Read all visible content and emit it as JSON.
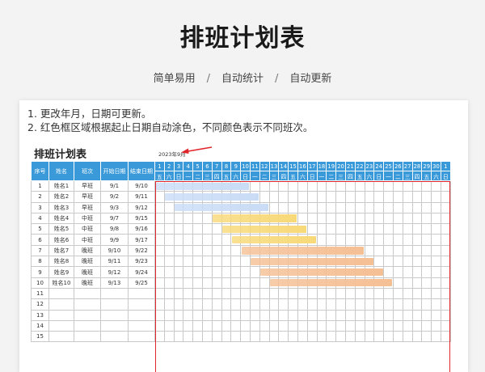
{
  "title": "排班计划表",
  "subtitle": {
    "items": [
      "简单易用",
      "自动统计",
      "自动更新"
    ],
    "separator": "/"
  },
  "notes": [
    "1. 更改年月，日期可更新。",
    "2. 红色框区域根据起止日期自动涂色，不同颜色表示不同班次。"
  ],
  "sheet": {
    "title": "排班计划表",
    "month_label": "2023年9月",
    "columns": [
      "序号",
      "姓名",
      "班次",
      "开始日期",
      "结束日期"
    ],
    "days": [
      "1",
      "2",
      "3",
      "4",
      "5",
      "6",
      "7",
      "8",
      "9",
      "10",
      "11",
      "12",
      "13",
      "14",
      "15",
      "16",
      "17",
      "18",
      "19",
      "20",
      "21",
      "22",
      "23",
      "24",
      "25",
      "26",
      "27",
      "28",
      "29",
      "30",
      "1"
    ],
    "weekdays": [
      "五",
      "六",
      "日",
      "一",
      "二",
      "三",
      "四",
      "五",
      "六",
      "日",
      "一",
      "二",
      "三",
      "四",
      "五",
      "六",
      "日",
      "一",
      "二",
      "三",
      "四",
      "五",
      "六",
      "日",
      "一",
      "二",
      "三",
      "四",
      "五",
      "六",
      "日"
    ],
    "rows": [
      {
        "no": "1",
        "name": "姓名1",
        "shift": "早班",
        "start": "9/1",
        "end": "9/10",
        "s": 1,
        "e": 10,
        "color": "#c9dcf6"
      },
      {
        "no": "2",
        "name": "姓名2",
        "shift": "早班",
        "start": "9/2",
        "end": "9/11",
        "s": 2,
        "e": 11,
        "color": "#c9dcf6"
      },
      {
        "no": "3",
        "name": "姓名3",
        "shift": "早班",
        "start": "9/3",
        "end": "9/12",
        "s": 3,
        "e": 12,
        "color": "#c9dcf6"
      },
      {
        "no": "4",
        "name": "姓名4",
        "shift": "中班",
        "start": "9/7",
        "end": "9/15",
        "s": 7,
        "e": 15,
        "color": "#f8d978"
      },
      {
        "no": "5",
        "name": "姓名5",
        "shift": "中班",
        "start": "9/8",
        "end": "9/16",
        "s": 8,
        "e": 16,
        "color": "#f8d978"
      },
      {
        "no": "6",
        "name": "姓名6",
        "shift": "中班",
        "start": "9/9",
        "end": "9/17",
        "s": 9,
        "e": 17,
        "color": "#f8d978"
      },
      {
        "no": "7",
        "name": "姓名7",
        "shift": "晚班",
        "start": "9/10",
        "end": "9/22",
        "s": 10,
        "e": 22,
        "color": "#f5bf94"
      },
      {
        "no": "8",
        "name": "姓名8",
        "shift": "晚班",
        "start": "9/11",
        "end": "9/23",
        "s": 11,
        "e": 23,
        "color": "#f5bf94"
      },
      {
        "no": "9",
        "name": "姓名9",
        "shift": "晚班",
        "start": "9/12",
        "end": "9/24",
        "s": 12,
        "e": 24,
        "color": "#f5bf94"
      },
      {
        "no": "10",
        "name": "姓名10",
        "shift": "晚班",
        "start": "9/13",
        "end": "9/25",
        "s": 13,
        "e": 25,
        "color": "#f5bf94"
      },
      {
        "no": "11",
        "name": "",
        "shift": "",
        "start": "",
        "end": ""
      },
      {
        "no": "12",
        "name": "",
        "shift": "",
        "start": "",
        "end": ""
      },
      {
        "no": "13",
        "name": "",
        "shift": "",
        "start": "",
        "end": ""
      },
      {
        "no": "14",
        "name": "",
        "shift": "",
        "start": "",
        "end": ""
      },
      {
        "no": "15",
        "name": "",
        "shift": "",
        "start": "",
        "end": ""
      }
    ],
    "colors": {
      "header": "#3a9ad9",
      "frame": "#e0262b",
      "arrow": "#e0262b"
    }
  }
}
